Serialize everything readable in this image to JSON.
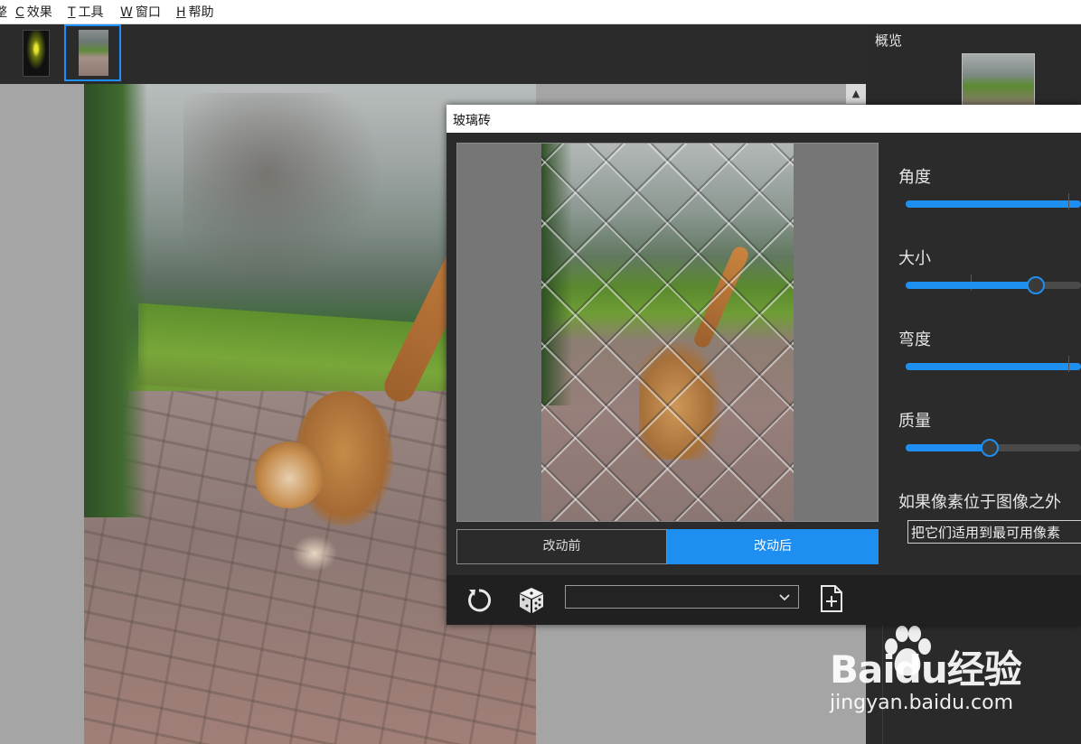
{
  "menubar": {
    "items": [
      {
        "key": "",
        "label": "整"
      },
      {
        "key": "C",
        "label": "效果"
      },
      {
        "key": "T",
        "label": "工具"
      },
      {
        "key": "W",
        "label": "窗口"
      },
      {
        "key": "H",
        "label": "帮助"
      }
    ]
  },
  "right_panel": {
    "overview_title": "概览"
  },
  "dialog": {
    "title": "玻璃砖",
    "before_label": "改动前",
    "after_label": "改动后",
    "active_view": "改动后",
    "preset_value": "",
    "params": [
      {
        "label": "角度",
        "value": 1.0
      },
      {
        "label": "大小",
        "value": 0.73
      },
      {
        "label": "弯度",
        "value": 1.0
      },
      {
        "label": "质量",
        "value": 0.47
      }
    ],
    "outside_label": "如果像素位于图像之外",
    "outside_value": "把它们适用到最可用像素"
  },
  "watermark": {
    "brand": "Baidu经验",
    "url": "jingyan.baidu.com"
  },
  "colors": {
    "accent": "#1e8ff0",
    "selection_border": "#1e90ff",
    "panel_bg": "#2b2b2b"
  },
  "icons": {
    "reset": "reset-icon",
    "random": "dice-icon",
    "dropdown": "chevron-down-icon",
    "new_preset": "add-preset-icon",
    "scroll_up": "caret-up-icon"
  }
}
